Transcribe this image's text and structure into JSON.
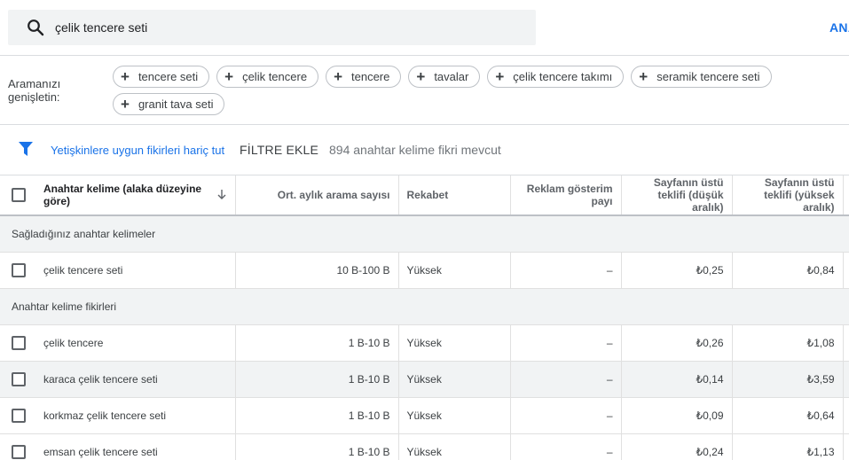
{
  "search": {
    "query": "çelik tencere seti",
    "analyze_link": "ANALİZ"
  },
  "broaden": {
    "label": "Aramanızı genişletin:",
    "chips": [
      "tencere seti",
      "çelik tencere",
      "tencere",
      "tavalar",
      "çelik tencere takımı",
      "seramik tencere seti",
      "granit tava seti"
    ]
  },
  "filters": {
    "active_filter": "Yetişkinlere uygun fikirleri hariç tut",
    "add_filter": "FİLTRE EKLE",
    "idea_count": "894 anahtar kelime fikri mevcut"
  },
  "table": {
    "headers": {
      "keyword": "Anahtar kelime (alaka düzeyine göre)",
      "avg_searches": "Ort. aylık arama sayısı",
      "competition": "Rekabet",
      "impression_share": "Reklam gösterim payı",
      "top_bid_low": "Sayfanın üstü teklifi (düşük aralık)",
      "top_bid_high": "Sayfanın üstü teklifi (yüksek aralık)"
    },
    "groups": {
      "provided": "Sağladığınız anahtar kelimeler",
      "ideas": "Anahtar kelime fikirleri"
    },
    "provided_rows": [
      {
        "keyword": "çelik tencere seti",
        "avg": "10 B-100 B",
        "competition": "Yüksek",
        "share": "–",
        "low": "₺0,25",
        "high": "₺0,84"
      }
    ],
    "idea_rows": [
      {
        "keyword": "çelik tencere",
        "avg": "1 B-10 B",
        "competition": "Yüksek",
        "share": "–",
        "low": "₺0,26",
        "high": "₺1,08"
      },
      {
        "keyword": "karaca çelik tencere seti",
        "avg": "1 B-10 B",
        "competition": "Yüksek",
        "share": "–",
        "low": "₺0,14",
        "high": "₺3,59"
      },
      {
        "keyword": "korkmaz çelik tencere seti",
        "avg": "1 B-10 B",
        "competition": "Yüksek",
        "share": "–",
        "low": "₺0,09",
        "high": "₺0,64"
      },
      {
        "keyword": "emsan çelik tencere seti",
        "avg": "1 B-10 B",
        "competition": "Yüksek",
        "share": "–",
        "low": "₺0,24",
        "high": "₺1,13"
      }
    ]
  },
  "colors": {
    "accent": "#1a73e8",
    "group_bg": "#f1f3f4"
  }
}
